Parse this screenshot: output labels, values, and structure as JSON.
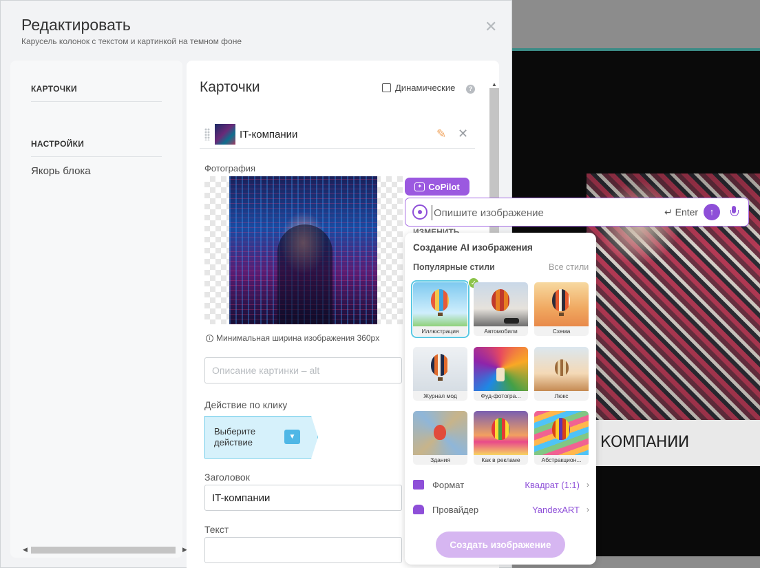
{
  "modal": {
    "title": "Редактировать",
    "subtitle": "Карусель колонок с текстом и картинкой на темном фоне"
  },
  "sidebar": {
    "cards_section": "КАРТОЧКИ",
    "settings_section": "НАСТРОЙКИ",
    "anchor_link": "Якорь блока"
  },
  "panel": {
    "title": "Карточки",
    "dynamic_label": "Динамические",
    "help_icon_text": "?",
    "card_name": "IT-компании",
    "photo_label": "Фотография",
    "change_button": "ИЗМЕНИТЬ",
    "min_width_hint": "Минимальная ширина изображения 360px",
    "alt_placeholder": "Описание картинки – alt",
    "click_action_label": "Действие по клику",
    "click_action_value": "Выберите действие",
    "heading_label": "Заголовок",
    "heading_value": "IT-компании",
    "text_label": "Текст"
  },
  "preview": {
    "caption": "Е КОМПАНИИ"
  },
  "copilot": {
    "badge": "CoPilot",
    "prompt_placeholder": "Опишите изображение",
    "enter_label": "Enter",
    "ai_title": "Создание AI изображения",
    "popular_styles": "Популярные стили",
    "all_styles": "Все стили",
    "styles": [
      {
        "label": "Иллюстрация",
        "selected": true
      },
      {
        "label": "Автомобили",
        "selected": false
      },
      {
        "label": "Схема",
        "selected": false
      },
      {
        "label": "Журнал мод",
        "selected": false
      },
      {
        "label": "Фуд-фотогра...",
        "selected": false
      },
      {
        "label": "Люкс",
        "selected": false
      },
      {
        "label": "Здания",
        "selected": false
      },
      {
        "label": "Как в рекламе",
        "selected": false
      },
      {
        "label": "Абстракцион...",
        "selected": false
      }
    ],
    "format_label": "Формат",
    "format_value": "Квадрат (1:1)",
    "provider_label": "Провайдер",
    "provider_value": "YandexART",
    "create_button": "Создать изображение"
  },
  "colors": {
    "accent_purple": "#8e4fd8",
    "accent_blue": "#4fb7e6",
    "selected_outline": "#5ac8e3"
  }
}
